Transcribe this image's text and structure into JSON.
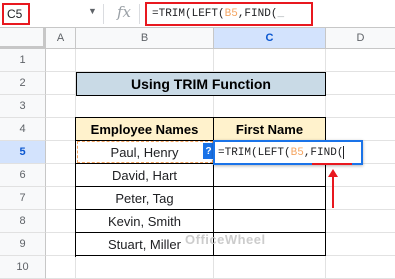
{
  "formula_bar": {
    "cell_ref": "C5",
    "name_arrow": "▼",
    "fx": "fx",
    "formula_prefix": "=TRIM(LEFT(",
    "formula_ref": "B5",
    "formula_suffix": ",FIND(",
    "cursor_mark": "_"
  },
  "columns": [
    "A",
    "B",
    "C",
    "D"
  ],
  "selected_column": "C",
  "rows": [
    "1",
    "2",
    "3",
    "4",
    "5",
    "6",
    "7",
    "8",
    "9",
    "10"
  ],
  "selected_row": "5",
  "sheet": {
    "title": "Using TRIM Function",
    "headers": {
      "names": "Employee Names",
      "first": "First Name"
    },
    "employees": [
      "Paul, Henry",
      "David, Hart",
      "Peter, Tag",
      "Kevin, Smith",
      "Stuart, Miller"
    ]
  },
  "editor": {
    "help_icon": "?",
    "prefix": "=TRIM(LEFT(",
    "ref": "B5",
    "suffix": ",FIND("
  },
  "watermark": "OfficeWheel",
  "colors": {
    "highlight": "#e8181f",
    "title_fill": "#c9dae6",
    "header_fill": "#fff2cc",
    "ref_orange": "#f4a460"
  }
}
